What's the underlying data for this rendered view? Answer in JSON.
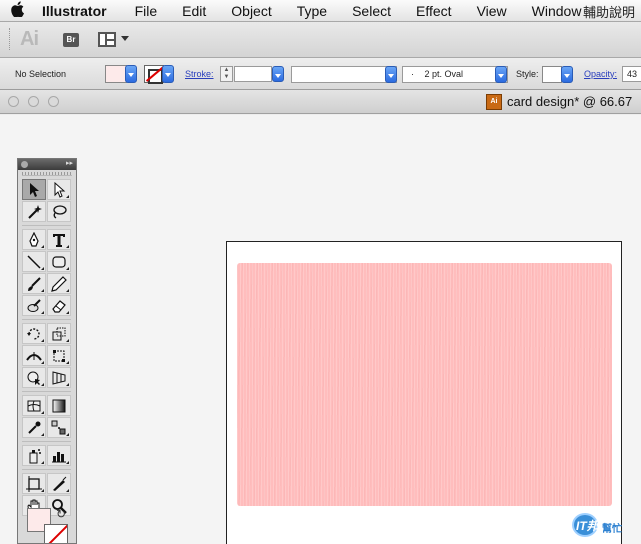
{
  "menubar": {
    "app_name": "Illustrator",
    "items": [
      "File",
      "Edit",
      "Object",
      "Type",
      "Select",
      "Effect",
      "View",
      "Window"
    ],
    "right_text": "輔助說明"
  },
  "appbar": {
    "logo_text": "Ai",
    "bridge_label": "Br"
  },
  "controlbar": {
    "selection_status": "No Selection",
    "stroke_label": "Stroke:",
    "brush_value": "",
    "brush_profile": "2 pt. Oval",
    "brush_dot": "·",
    "style_label": "Style:",
    "opacity_label": "Opacity:",
    "opacity_value": "43",
    "fill_color": "#fdeaea"
  },
  "document": {
    "title": "card design* @ 66.67",
    "icon_label": "Ai"
  },
  "canvas": {
    "card_color": "#ffbdbd"
  },
  "tools": {
    "swap_icon": "↻"
  },
  "watermark": {
    "brand": "IT邦",
    "sub": "幫忙"
  }
}
